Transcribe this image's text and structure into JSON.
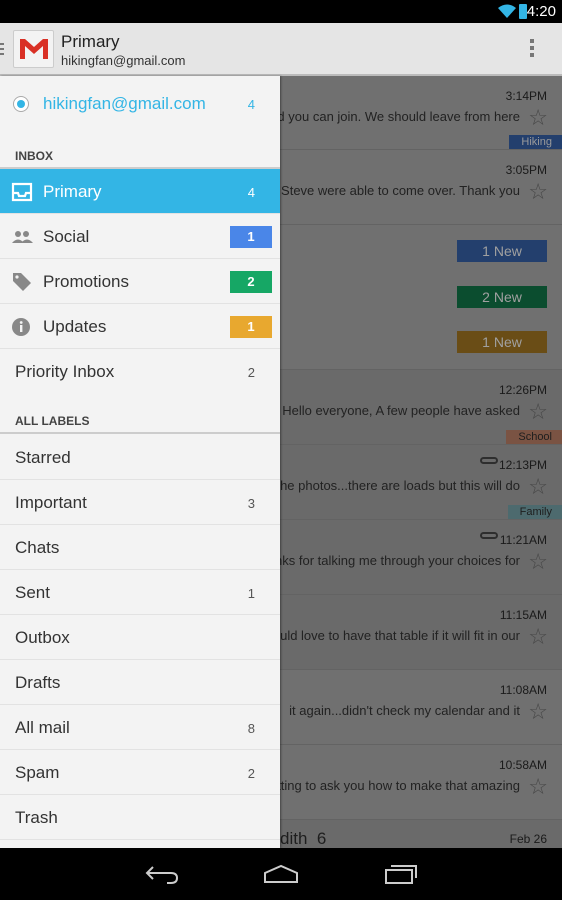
{
  "status": {
    "time": "4:20"
  },
  "appbar": {
    "title": "Primary",
    "account": "hikingfan@gmail.com"
  },
  "drawer": {
    "account": {
      "email": "hikingfan@gmail.com",
      "count": "4"
    },
    "inbox_header": "INBOX",
    "inbox": [
      {
        "label": "Primary",
        "count": "4",
        "icon": "inbox-icon",
        "selected": true
      },
      {
        "label": "Social",
        "count": "1",
        "icon": "people-icon",
        "color": "#4a86e8"
      },
      {
        "label": "Promotions",
        "count": "2",
        "icon": "tag-icon",
        "color": "#16a765"
      },
      {
        "label": "Updates",
        "count": "1",
        "icon": "info-icon",
        "color": "#e8a82f"
      },
      {
        "label": "Priority Inbox",
        "count": "2"
      }
    ],
    "labels_header": "ALL LABELS",
    "labels": [
      {
        "label": "Starred",
        "count": ""
      },
      {
        "label": "Important",
        "count": "3"
      },
      {
        "label": "Chats",
        "count": ""
      },
      {
        "label": "Sent",
        "count": "1"
      },
      {
        "label": "Outbox",
        "count": ""
      },
      {
        "label": "Drafts",
        "count": ""
      },
      {
        "label": "All mail",
        "count": "8"
      },
      {
        "label": "Spam",
        "count": "2"
      },
      {
        "label": "Trash",
        "count": ""
      }
    ]
  },
  "emails": [
    {
      "time": "3:14PM",
      "snippet": "d you can join. We should leave from here",
      "label": "Hiking",
      "label_color": "#4a86e8"
    },
    {
      "time": "3:05PM",
      "snippet": "and Steve were able to come over. Thank you"
    },
    {
      "categories": [
        {
          "text": "1 New",
          "color": "#4a86e8"
        },
        {
          "text": "2 New",
          "color": "#16a765"
        },
        {
          "text": "1 New",
          "color": "#e8a82f"
        }
      ]
    },
    {
      "time": "12:26PM",
      "snippet": "– Hello everyone, A few people have asked",
      "label": "School",
      "label_color": "#f2a384"
    },
    {
      "time": "12:13PM",
      "snippet": "the photos...there are loads but this will do",
      "label": "Family",
      "label_color": "#9fd8e0",
      "attachment": true
    },
    {
      "time": "11:21AM",
      "snippet": "nks for talking me through your choices for",
      "attachment": true
    },
    {
      "time": "11:15AM",
      "snippet": "would love to have that table if it will fit in our"
    },
    {
      "time": "11:08AM",
      "snippet": "it again...didn't check my calendar and it"
    },
    {
      "time": "10:58AM",
      "snippet": "getting to ask you how to make that amazing"
    },
    {
      "sender": "dith  6",
      "time": "Feb 26"
    }
  ],
  "colors": {
    "accent": "#33b5e5"
  }
}
